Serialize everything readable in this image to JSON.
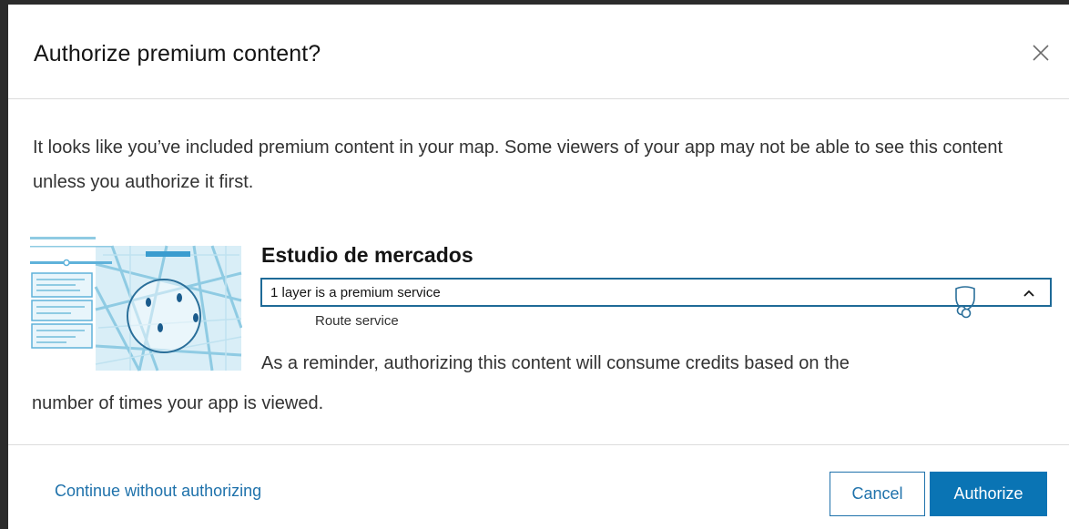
{
  "dialog": {
    "title": "Authorize premium content?",
    "close_icon": "close-icon",
    "intro": "It looks like you’ve included premium content in your map. Some viewers of your app may not be able to see this content unless you authorize it first."
  },
  "item": {
    "title": "Estudio de mercados",
    "accordion_label": "1 layer is a premium service",
    "accordion_expanded": true,
    "icons": [
      "premium-shield-icon",
      "chevron-up-icon"
    ],
    "layers": [
      "Route service"
    ]
  },
  "reminder": {
    "line1": "As a reminder, authorizing this content will consume credits based on the",
    "line2": "number of times your app is viewed."
  },
  "footer": {
    "continue_label": "Continue without authorizing",
    "cancel_label": "Cancel",
    "authorize_label": "Authorize"
  },
  "colors": {
    "accent": "#0a74b4",
    "link": "#1f72ab",
    "accordion_border": "#1e6a97"
  }
}
